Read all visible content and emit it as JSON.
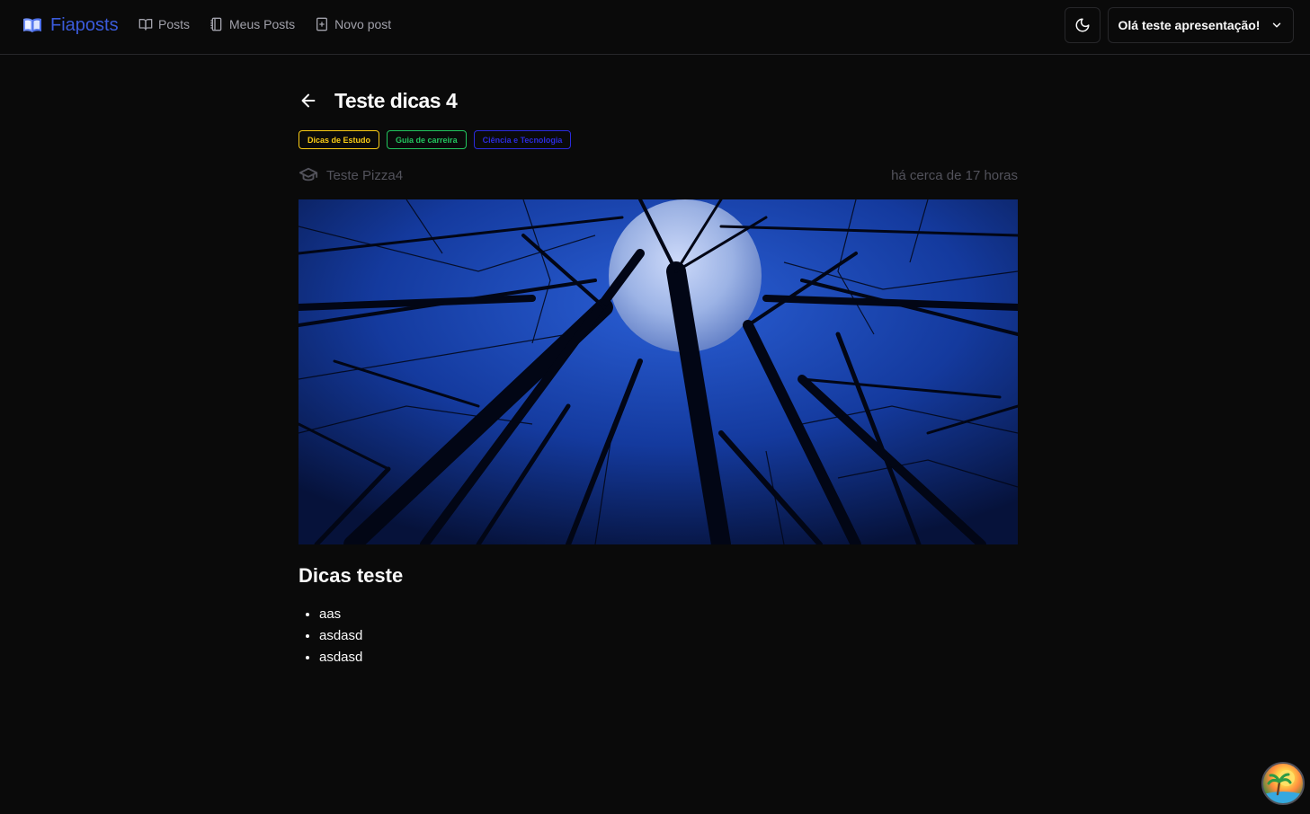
{
  "app": {
    "brand": "Fiaposts"
  },
  "nav": {
    "posts": "Posts",
    "my_posts": "Meus Posts",
    "new_post": "Novo post"
  },
  "user": {
    "greeting": "Olá teste apresentação!"
  },
  "post": {
    "title": "Teste dicas 4",
    "tags": [
      {
        "label": "Dicas de Estudo",
        "color": "#facc15"
      },
      {
        "label": "Guia de carreira",
        "color": "#22c55e"
      },
      {
        "label": "Ciência e Tecnologia",
        "color": "#2b2bdc"
      }
    ],
    "author": "Teste Pizza4",
    "time": "há cerca de 17 horas",
    "content_heading": "Dicas teste",
    "bullets": [
      "aas",
      "asdasd",
      "asdasd"
    ]
  },
  "colors": {
    "brand": "#3b5bdb",
    "background": "#0a0a0a",
    "muted": "#52525b"
  },
  "icons": [
    "book-open-icon",
    "book-icon",
    "notebook-icon",
    "file-plus-icon",
    "moon-icon",
    "chevron-down-icon",
    "arrow-left-icon",
    "graduation-cap-icon"
  ]
}
